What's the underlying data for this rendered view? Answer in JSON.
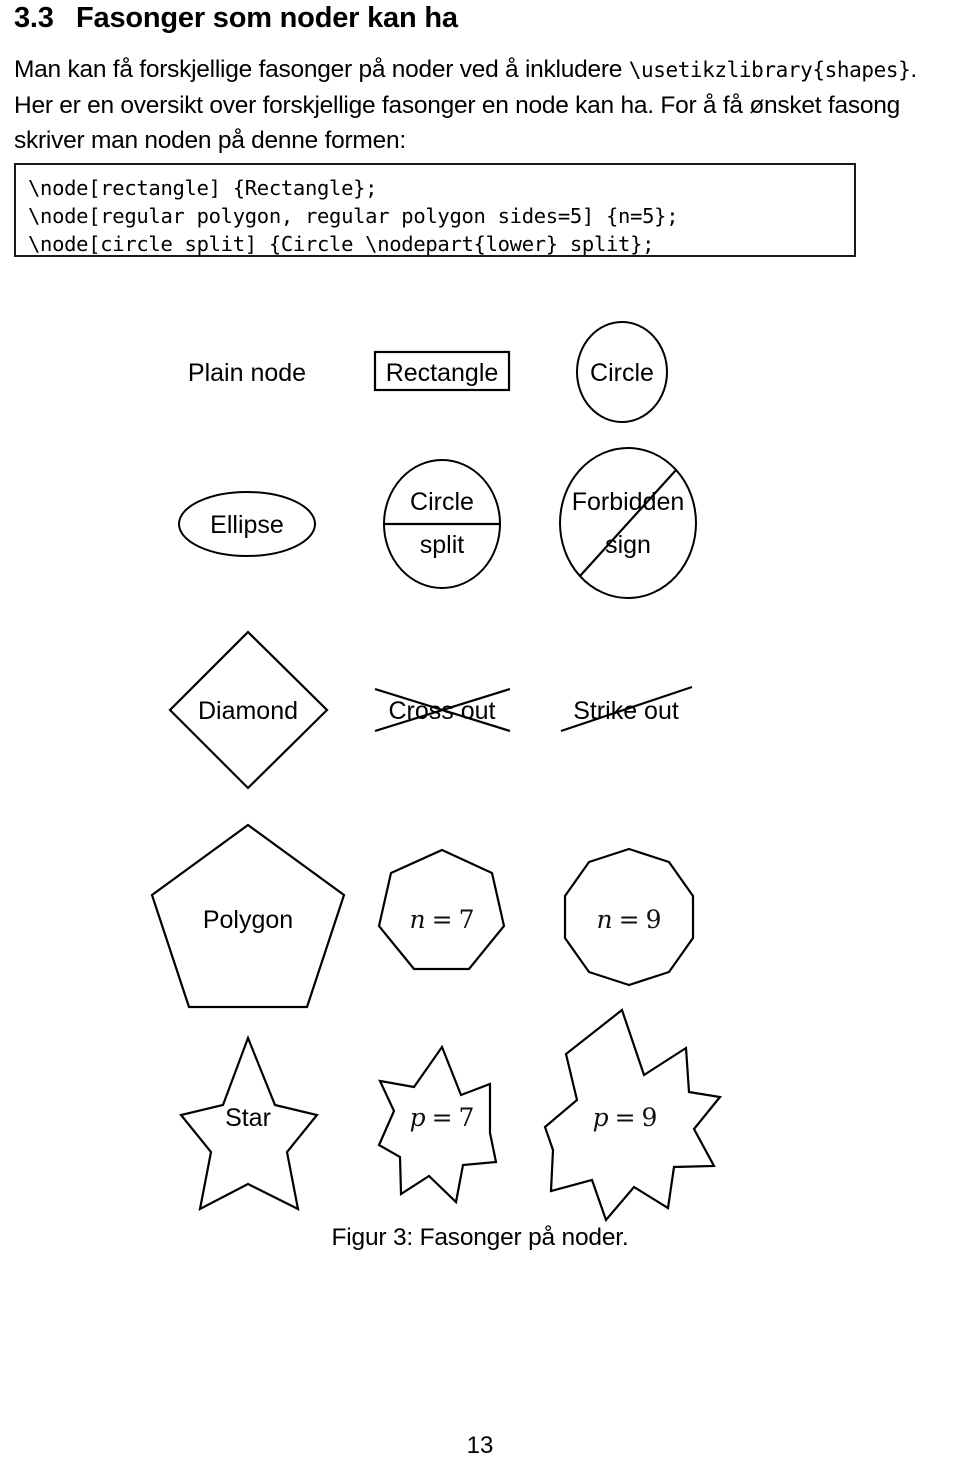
{
  "document": {
    "section_number": "3.3",
    "section_title": "Fasonger som noder kan ha",
    "paragraph_part1": "Man kan få forskjellige fasonger på noder ved å inkludere ",
    "paragraph_code1": "\\usetikzlibrary{shapes}",
    "paragraph_part2": ". Her er en oversikt over forskjellige fasonger en node kan ha. For å få ønsket fasong skriver man noden på denne formen:",
    "caption": "Figur 3: Fasonger på noder.",
    "page_number": "13"
  },
  "code_block": {
    "lines": [
      "\\node[rectangle] {Rectangle};",
      "\\node[regular polygon, regular polygon sides=5] {n=5};",
      "\\node[circle split] {Circle \\nodepart{lower} split};"
    ]
  },
  "figure": {
    "rows": [
      {
        "cells": [
          {
            "shape": "plain",
            "label": "Plain node"
          },
          {
            "shape": "rectangle",
            "label": "Rectangle"
          },
          {
            "shape": "circle",
            "label": "Circle"
          }
        ]
      },
      {
        "cells": [
          {
            "shape": "ellipse",
            "label": "Ellipse"
          },
          {
            "shape": "circle-split",
            "label_upper": "Circle",
            "label_lower": "split"
          },
          {
            "shape": "forbidden-sign",
            "label_upper": "Forbidden",
            "label_lower": "sign"
          }
        ]
      },
      {
        "cells": [
          {
            "shape": "diamond",
            "label": "Diamond"
          },
          {
            "shape": "cross-out",
            "label": "Cross out"
          },
          {
            "shape": "strike-out",
            "label": "Strike out"
          }
        ]
      },
      {
        "cells": [
          {
            "shape": "regular-polygon-5",
            "label": "Polygon"
          },
          {
            "shape": "regular-polygon-7",
            "label_var": "n",
            "label_op": "=",
            "label_val": "7"
          },
          {
            "shape": "regular-polygon-9",
            "label_var": "n",
            "label_op": "=",
            "label_val": "9"
          }
        ]
      },
      {
        "cells": [
          {
            "shape": "star-5",
            "label": "Star"
          },
          {
            "shape": "star-7",
            "label_var": "p",
            "label_op": "=",
            "label_val": "7"
          },
          {
            "shape": "star-9",
            "label_var": "p",
            "label_op": "=",
            "label_val": "9"
          }
        ]
      }
    ]
  },
  "colors": {
    "ink": "#000000",
    "paper": "#ffffff"
  }
}
